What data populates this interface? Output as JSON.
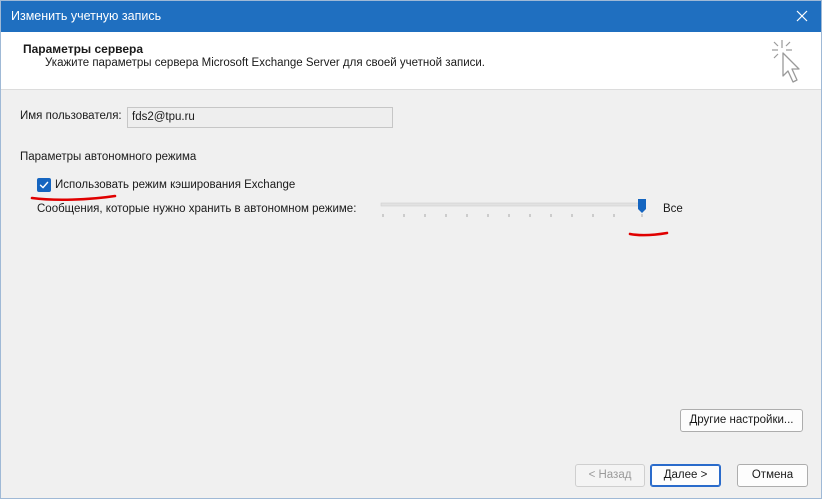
{
  "window": {
    "title": "Изменить учетную запись"
  },
  "header": {
    "title": "Параметры сервера",
    "subtitle": "Укажите параметры сервера Microsoft Exchange Server для своей учетной записи.",
    "icon": "cursor-click-icon"
  },
  "username": {
    "label": "Имя пользователя:",
    "value": "fds2@tpu.ru"
  },
  "offline": {
    "section_label": "Параметры автономного режима",
    "checkbox_label": "Использовать режим кэширования Exchange",
    "checkbox_checked": true,
    "slider_label": "Сообщения, которые нужно хранить в автономном режиме:",
    "slider_value_label": "Все",
    "slider_level": 1.0
  },
  "buttons": {
    "more_settings": "Другие настройки...",
    "back": "< Назад",
    "next": "Далее >",
    "cancel": "Отмена"
  },
  "colors": {
    "titlebar": "#1f6fc0",
    "accent": "#1565c0",
    "annotation": "#e00000"
  }
}
